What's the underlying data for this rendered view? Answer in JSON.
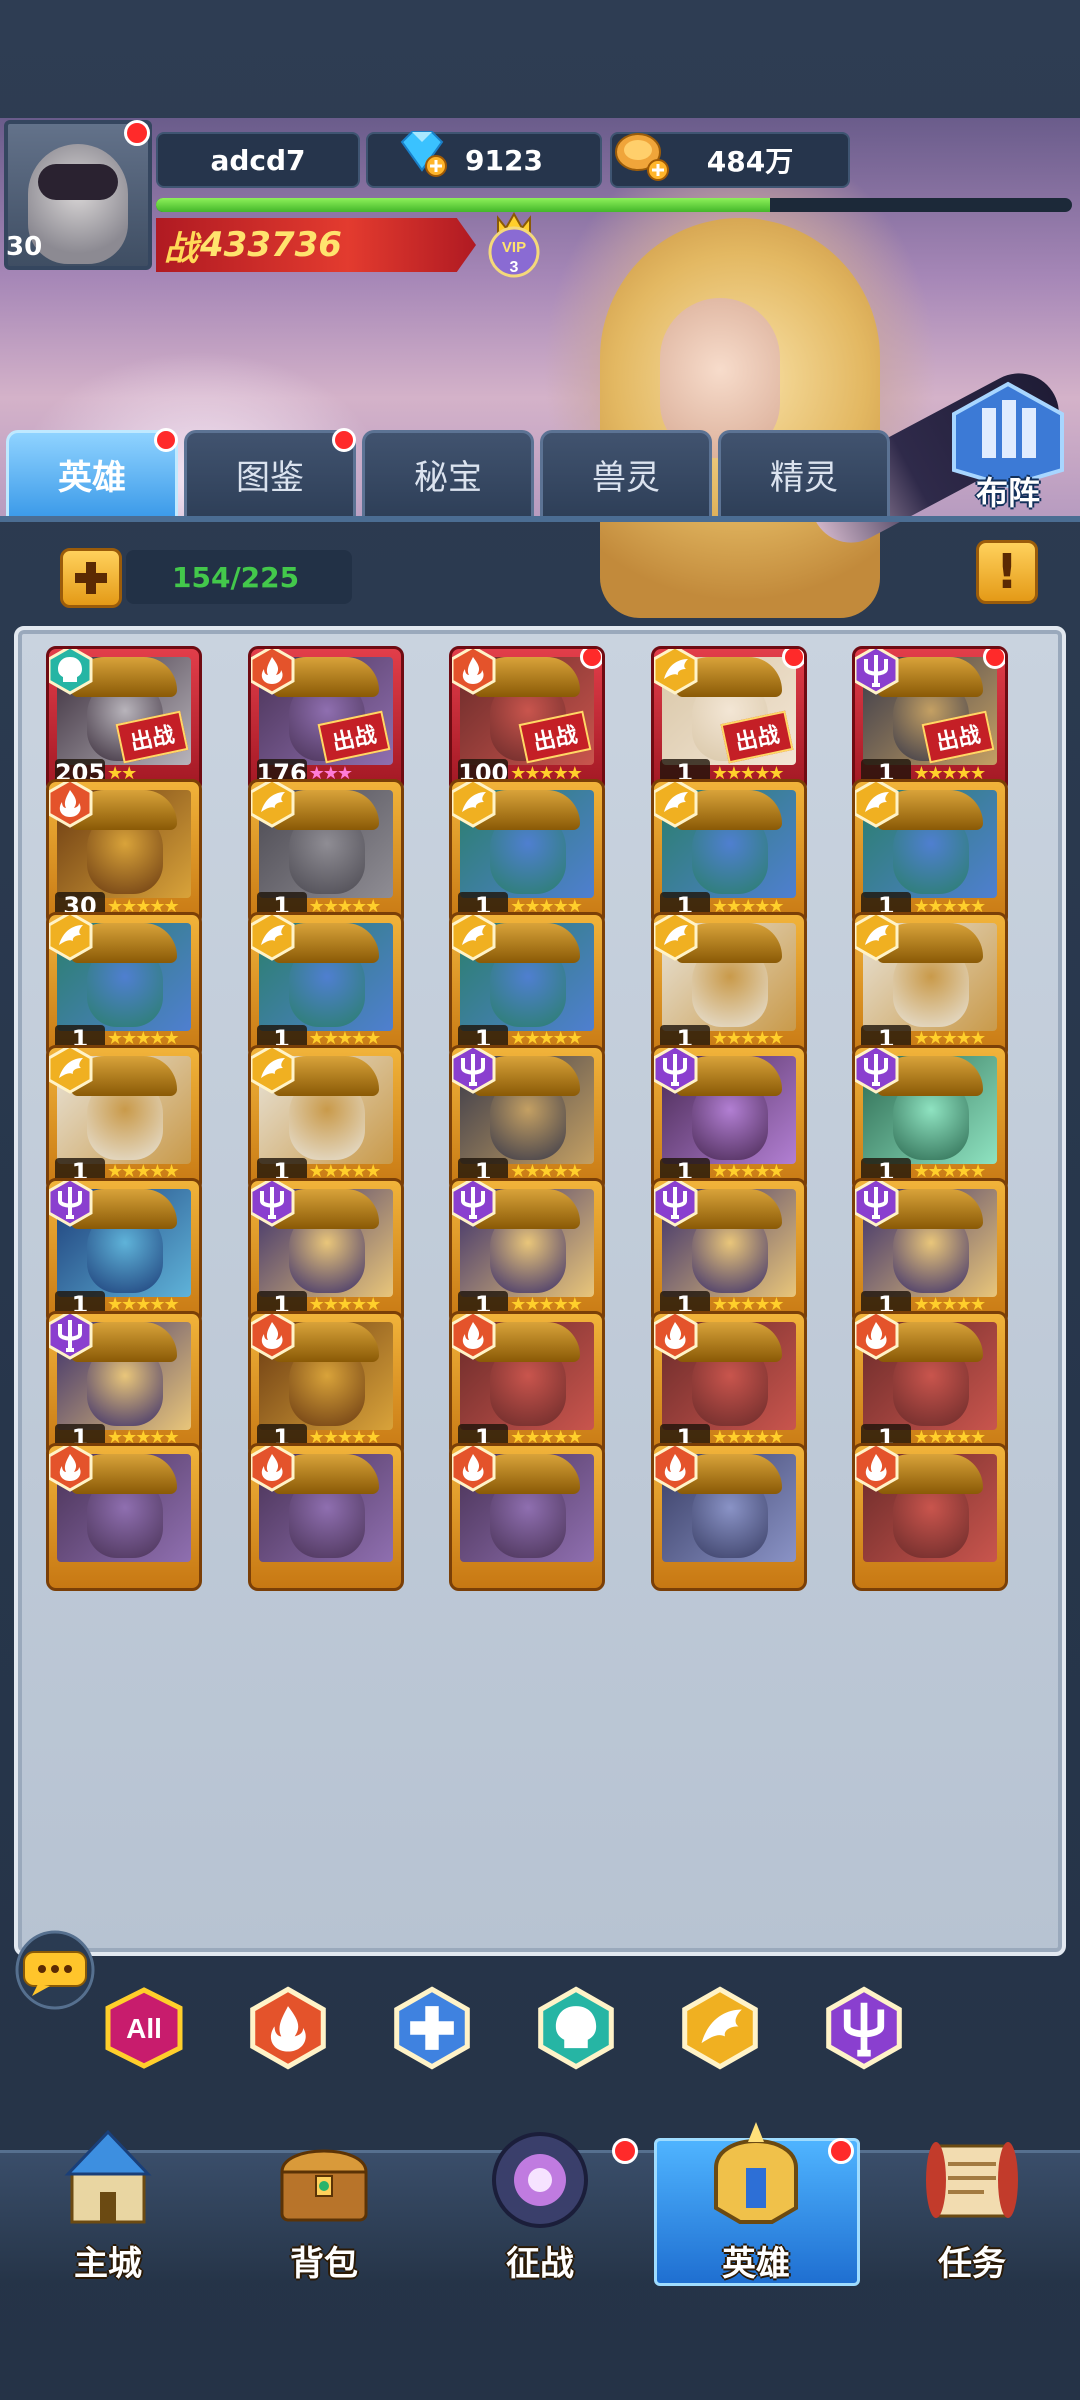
{
  "player": {
    "name": "adcd7",
    "level": "30",
    "gems": "9123",
    "gold": "484万",
    "power_label": "战",
    "power": "433736",
    "vip_label": "VIP",
    "vip_level": "3",
    "xp_progress": 0.67
  },
  "tabs": [
    {
      "label": "英雄",
      "active": true,
      "dot": true
    },
    {
      "label": "图鉴",
      "active": false,
      "dot": true
    },
    {
      "label": "秘宝",
      "active": false,
      "dot": false
    },
    {
      "label": "兽灵",
      "active": false,
      "dot": false
    },
    {
      "label": "精灵",
      "active": false,
      "dot": false
    }
  ],
  "formation_label": "布阵",
  "capacity": "154/225",
  "add_button_icon": "plus-icon",
  "info_button_icon": "exclamation-icon",
  "info_button_text": "!",
  "battle_tag": "出战",
  "heroes": [
    {
      "level": "205",
      "faction": "skull",
      "deployed": true,
      "dot": false,
      "stars_pink": false,
      "stars": "★★",
      "colors": [
        "#3c2f3d",
        "#b8b4bb"
      ]
    },
    {
      "level": "176",
      "faction": "fire",
      "deployed": true,
      "dot": false,
      "stars_pink": true,
      "stars": "★★★",
      "colors": [
        "#4a3357",
        "#8f6fb0"
      ]
    },
    {
      "level": "100",
      "faction": "fire",
      "deployed": true,
      "dot": true,
      "stars_pink": false,
      "stars": "★★★★★",
      "colors": [
        "#6b2b2a",
        "#c9554d"
      ]
    },
    {
      "level": "1",
      "faction": "wing",
      "deployed": true,
      "dot": true,
      "stars_pink": false,
      "stars": "★★★★★",
      "colors": [
        "#d9c7a8",
        "#f3e6d5"
      ]
    },
    {
      "level": "1",
      "faction": "trident",
      "deployed": true,
      "dot": true,
      "stars_pink": false,
      "stars": "★★★★★",
      "colors": [
        "#3a3a4a",
        "#c4a063"
      ]
    },
    {
      "level": "30",
      "faction": "fire",
      "deployed": false,
      "dot": false,
      "stars_pink": false,
      "stars": "★★★★★",
      "colors": [
        "#6b3b12",
        "#d9a33a"
      ]
    },
    {
      "level": "1",
      "faction": "wing",
      "deployed": false,
      "dot": false,
      "stars_pink": false,
      "stars": "★★★★★",
      "colors": [
        "#4c4a52",
        "#8f8d94"
      ]
    },
    {
      "level": "1",
      "faction": "wing",
      "deployed": false,
      "dot": false,
      "stars_pink": false,
      "stars": "★★★★★",
      "colors": [
        "#2b7f6c",
        "#4f7fd0"
      ]
    },
    {
      "level": "1",
      "faction": "wing",
      "deployed": false,
      "dot": false,
      "stars_pink": false,
      "stars": "★★★★★",
      "colors": [
        "#2b7f6c",
        "#4f7fd0"
      ]
    },
    {
      "level": "1",
      "faction": "wing",
      "deployed": false,
      "dot": false,
      "stars_pink": false,
      "stars": "★★★★★",
      "colors": [
        "#2b7f6c",
        "#4f7fd0"
      ]
    },
    {
      "level": "1",
      "faction": "wing",
      "deployed": false,
      "dot": false,
      "stars_pink": false,
      "stars": "★★★★★",
      "colors": [
        "#2b7f6c",
        "#4f7fd0"
      ]
    },
    {
      "level": "1",
      "faction": "wing",
      "deployed": false,
      "dot": false,
      "stars_pink": false,
      "stars": "★★★★★",
      "colors": [
        "#2b7f6c",
        "#4f7fd0"
      ]
    },
    {
      "level": "1",
      "faction": "wing",
      "deployed": false,
      "dot": false,
      "stars_pink": false,
      "stars": "★★★★★",
      "colors": [
        "#2b7f6c",
        "#4f7fd0"
      ]
    },
    {
      "level": "1",
      "faction": "wing",
      "deployed": false,
      "dot": false,
      "stars_pink": false,
      "stars": "★★★★★",
      "colors": [
        "#e8e3d8",
        "#c99a4a"
      ]
    },
    {
      "level": "1",
      "faction": "wing",
      "deployed": false,
      "dot": false,
      "stars_pink": false,
      "stars": "★★★★★",
      "colors": [
        "#e8e3d8",
        "#c99a4a"
      ]
    },
    {
      "level": "1",
      "faction": "wing",
      "deployed": false,
      "dot": false,
      "stars_pink": false,
      "stars": "★★★★★",
      "colors": [
        "#e8e3d8",
        "#c99a4a"
      ]
    },
    {
      "level": "1",
      "faction": "wing",
      "deployed": false,
      "dot": false,
      "stars_pink": false,
      "stars": "★★★★★",
      "colors": [
        "#e8e3d8",
        "#c99a4a"
      ]
    },
    {
      "level": "1",
      "faction": "trident",
      "deployed": false,
      "dot": false,
      "stars_pink": false,
      "stars": "★★★★★",
      "colors": [
        "#3a3a4a",
        "#c4a063"
      ]
    },
    {
      "level": "1",
      "faction": "trident",
      "deployed": false,
      "dot": false,
      "stars_pink": false,
      "stars": "★★★★★",
      "colors": [
        "#4a2a55",
        "#b27fd3"
      ]
    },
    {
      "level": "1",
      "faction": "trident",
      "deployed": false,
      "dot": false,
      "stars_pink": false,
      "stars": "★★★★★",
      "colors": [
        "#2d6b52",
        "#8fe3c1"
      ]
    },
    {
      "level": "1",
      "faction": "trident",
      "deployed": false,
      "dot": false,
      "stars_pink": false,
      "stars": "★★★★★",
      "colors": [
        "#1e3f7a",
        "#5fb3d9"
      ]
    },
    {
      "level": "1",
      "faction": "trident",
      "deployed": false,
      "dot": false,
      "stars_pink": false,
      "stars": "★★★★★",
      "colors": [
        "#3b2f6b",
        "#e9c67a"
      ]
    },
    {
      "level": "1",
      "faction": "trident",
      "deployed": false,
      "dot": false,
      "stars_pink": false,
      "stars": "★★★★★",
      "colors": [
        "#3b2f6b",
        "#e9c67a"
      ]
    },
    {
      "level": "1",
      "faction": "trident",
      "deployed": false,
      "dot": false,
      "stars_pink": false,
      "stars": "★★★★★",
      "colors": [
        "#3b2f6b",
        "#e9c67a"
      ]
    },
    {
      "level": "1",
      "faction": "trident",
      "deployed": false,
      "dot": false,
      "stars_pink": false,
      "stars": "★★★★★",
      "colors": [
        "#3b2f6b",
        "#e9c67a"
      ]
    },
    {
      "level": "1",
      "faction": "trident",
      "deployed": false,
      "dot": false,
      "stars_pink": false,
      "stars": "★★★★★",
      "colors": [
        "#3b2f6b",
        "#e9c67a"
      ]
    },
    {
      "level": "1",
      "faction": "fire",
      "deployed": false,
      "dot": false,
      "stars_pink": false,
      "stars": "★★★★★",
      "colors": [
        "#6b3b12",
        "#d9a33a"
      ]
    },
    {
      "level": "1",
      "faction": "fire",
      "deployed": false,
      "dot": false,
      "stars_pink": false,
      "stars": "★★★★★",
      "colors": [
        "#6b2b2a",
        "#c9554d"
      ]
    },
    {
      "level": "1",
      "faction": "fire",
      "deployed": false,
      "dot": false,
      "stars_pink": false,
      "stars": "★★★★★",
      "colors": [
        "#6b2b2a",
        "#c9554d"
      ]
    },
    {
      "level": "1",
      "faction": "fire",
      "deployed": false,
      "dot": false,
      "stars_pink": false,
      "stars": "★★★★★",
      "colors": [
        "#6b2b2a",
        "#c9554d"
      ]
    }
  ],
  "partial_heroes": [
    {
      "faction": "fire",
      "colors": [
        "#4a3357",
        "#8f6fb0"
      ]
    },
    {
      "faction": "fire",
      "colors": [
        "#4a3357",
        "#8f6fb0"
      ]
    },
    {
      "faction": "fire",
      "colors": [
        "#4a3357",
        "#8f6fb0"
      ]
    },
    {
      "faction": "fire",
      "colors": [
        "#3a3f66",
        "#8a93c6"
      ]
    },
    {
      "faction": "fire",
      "colors": [
        "#6b2b2a",
        "#c9554d"
      ]
    }
  ],
  "filters": [
    {
      "name": "all",
      "label": "All",
      "color": "#ffcf2b"
    },
    {
      "name": "fire",
      "label": "",
      "color": "#e4532b"
    },
    {
      "name": "cross",
      "label": "",
      "color": "#3f82e0"
    },
    {
      "name": "skull",
      "label": "",
      "color": "#26b5a4"
    },
    {
      "name": "wing",
      "label": "",
      "color": "#f0b021"
    },
    {
      "name": "trident",
      "label": "",
      "color": "#8a3fcf"
    }
  ],
  "colors": {
    "fire": "#e4532b",
    "wing": "#f0b021",
    "trident": "#8a3fcf",
    "skull": "#26b5a4",
    "cross": "#3f82e0"
  },
  "nav": [
    {
      "label": "主城",
      "icon": "castle-icon",
      "active": false,
      "dot": false
    },
    {
      "label": "背包",
      "icon": "treasure-chest-icon",
      "active": false,
      "dot": false
    },
    {
      "label": "征战",
      "icon": "dragon-portal-icon",
      "active": false,
      "dot": true
    },
    {
      "label": "英雄",
      "icon": "hero-helmet-icon",
      "active": true,
      "dot": true
    },
    {
      "label": "任务",
      "icon": "scroll-icon",
      "active": false,
      "dot": false
    }
  ]
}
